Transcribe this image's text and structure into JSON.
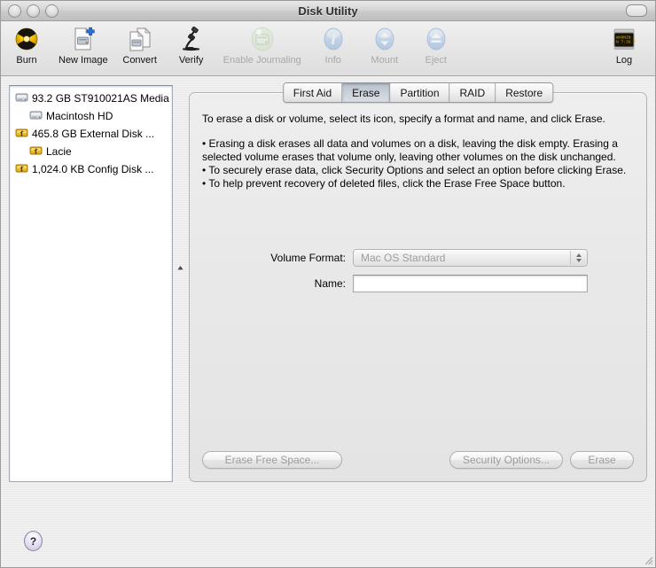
{
  "window": {
    "title": "Disk Utility",
    "traffic_lights": [
      "close",
      "minimize",
      "zoom"
    ]
  },
  "toolbar": {
    "items": [
      {
        "label": "Burn",
        "icon": "burn-icon",
        "enabled": true
      },
      {
        "label": "New Image",
        "icon": "new-image-icon",
        "enabled": true
      },
      {
        "label": "Convert",
        "icon": "convert-icon",
        "enabled": true
      },
      {
        "label": "Verify",
        "icon": "verify-microscope-icon",
        "enabled": true
      },
      {
        "label": "Enable Journaling",
        "icon": "enable-journaling-icon",
        "enabled": false
      },
      {
        "label": "Info",
        "icon": "info-icon",
        "enabled": false
      },
      {
        "label": "Mount",
        "icon": "mount-icon",
        "enabled": false
      },
      {
        "label": "Eject",
        "icon": "eject-icon",
        "enabled": false
      }
    ],
    "log": {
      "label": "Log",
      "icon": "log-icon",
      "enabled": true
    }
  },
  "sidebar": {
    "disks": [
      {
        "label": "93.2 GB ST910021AS Media",
        "icon": "internal-drive-icon",
        "level": 0
      },
      {
        "label": "Macintosh HD",
        "icon": "volume-icon",
        "level": 1
      },
      {
        "label": "465.8 GB External Disk ...",
        "icon": "usb-drive-icon",
        "level": 0
      },
      {
        "label": "Lacie",
        "icon": "usb-volume-icon",
        "level": 1
      },
      {
        "label": "1,024.0 KB Config Disk ...",
        "icon": "usb-drive-icon",
        "level": 0
      }
    ]
  },
  "splitter": {
    "collapse_icon": "collapse-handle-icon"
  },
  "tabs": [
    {
      "label": "First Aid",
      "active": false
    },
    {
      "label": "Erase",
      "active": true
    },
    {
      "label": "Partition",
      "active": false
    },
    {
      "label": "RAID",
      "active": false
    },
    {
      "label": "Restore",
      "active": false
    }
  ],
  "erase_pane": {
    "intro": "To erase a disk or volume, select its icon, specify a format and name, and click Erase.",
    "bullets": [
      "• Erasing a disk erases all data and volumes on a disk, leaving the disk empty. Erasing a selected volume erases that volume only, leaving other volumes on the disk unchanged.",
      "• To securely erase data, click Security Options and select an option before clicking Erase.",
      "• To help prevent recovery of deleted files, click the Erase Free Space button."
    ],
    "volume_format": {
      "label": "Volume Format:",
      "value": "Mac OS Standard",
      "enabled": false
    },
    "name": {
      "label": "Name:",
      "value": "",
      "placeholder": "",
      "enabled": true
    },
    "buttons": [
      {
        "label": "Erase Free Space...",
        "enabled": false
      },
      {
        "label": "Security Options...",
        "enabled": false
      },
      {
        "label": "Erase",
        "enabled": false
      }
    ]
  },
  "footer": {
    "help_label": "?",
    "resize_grip": "resize-grip-icon"
  },
  "colors": {
    "window_bg": "#ededed",
    "sidebar_bg": "#ffffff",
    "panel_bg": "#e9e9e9",
    "tab_active": "#c9cfd8",
    "usb_icon": "#e8b422",
    "info_blue": "#7aa7e0",
    "help_purple": "#cfc4e4"
  }
}
